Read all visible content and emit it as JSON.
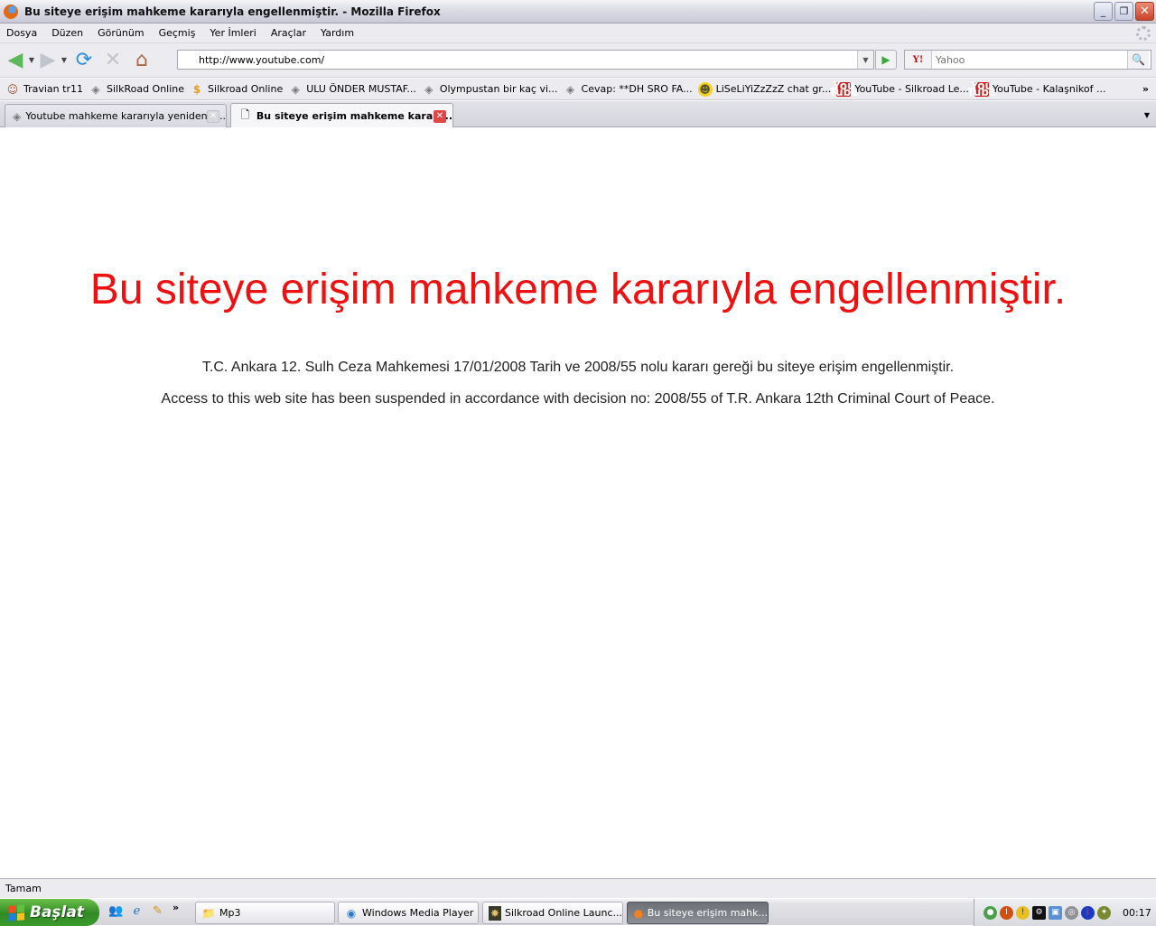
{
  "window": {
    "title": "Bu siteye erişim mahkeme kararıyla engellenmiştir. - Mozilla Firefox",
    "buttons": {
      "minimize": "_",
      "restore": "❐",
      "close": "✕"
    }
  },
  "menu": [
    "Dosya",
    "Düzen",
    "Görünüm",
    "Geçmiş",
    "Yer İmleri",
    "Araçlar",
    "Yardım"
  ],
  "nav": {
    "url": "http://www.youtube.com/",
    "search_placeholder": "Yahoo",
    "search_engine": "Y!",
    "icons": {
      "back": "◀",
      "forward": "▶",
      "reload": "⟳",
      "stop": "✕",
      "home": "⌂",
      "go": "▶",
      "search": "🔍",
      "dropdown": "▼"
    }
  },
  "bookmarks": [
    {
      "label": "Travian tr11",
      "icon": "person-icon"
    },
    {
      "label": "SilkRoad Online",
      "icon": "diamond-icon"
    },
    {
      "label": "Silkroad Online",
      "icon": "dollar-icon"
    },
    {
      "label": "ULU ÖNDER MUSTAF...",
      "icon": "diamond-icon"
    },
    {
      "label": "Olympustan bir kaç vi...",
      "icon": "diamond-icon"
    },
    {
      "label": "Cevap: **DH SRO FA...",
      "icon": "diamond-icon"
    },
    {
      "label": "LiSeLiYiZzZzZ chat gr...",
      "icon": "smiley-icon"
    },
    {
      "label": "YouTube - Silkroad Le...",
      "icon": "youtube-icon"
    },
    {
      "label": "YouTube - Kalaşnikof ...",
      "icon": "youtube-icon"
    }
  ],
  "bookmarks_more": "»",
  "tabs": [
    {
      "label": "Youtube mahkeme kararıyla yeniden k...",
      "active": false
    },
    {
      "label": "Bu siteye erişim mahkeme kararı...",
      "active": true
    }
  ],
  "page": {
    "heading": "Bu siteye erişim mahkeme kararıyla engellenmiştir.",
    "text_tr": "T.C. Ankara 12. Sulh Ceza Mahkemesi 17/01/2008 Tarih ve 2008/55 nolu kararı gereği bu siteye erişim engellenmiştir.",
    "text_en": "Access to this web site has been suspended in accordance with decision no: 2008/55 of T.R. Ankara 12th Criminal Court of Peace.",
    "heading_color": "#ee1111"
  },
  "status": "Tamam",
  "taskbar": {
    "start_label": "Başlat",
    "quicklaunch_more": "»",
    "tasks": [
      {
        "label": "Mp3",
        "icon": "folder-icon",
        "active": false
      },
      {
        "label": "Windows Media Player",
        "icon": "media-player-icon",
        "active": false
      },
      {
        "label": "Silkroad Online Launc...",
        "icon": "silkroad-icon",
        "active": false
      },
      {
        "label": "Bu siteye erişim mahk...",
        "icon": "firefox-icon",
        "active": true
      }
    ],
    "clock": "00:17"
  }
}
